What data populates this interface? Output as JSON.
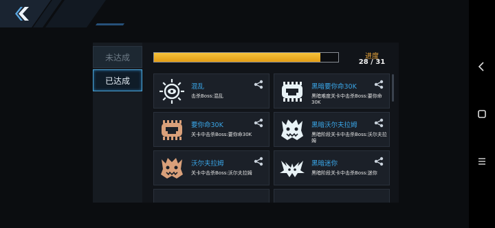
{
  "tabs": {
    "incomplete": "未达成",
    "complete": "已达成"
  },
  "progress": {
    "title": "进度",
    "count": "28 / 31",
    "fraction": 0.903
  },
  "achievements": [
    {
      "name": "混乱",
      "desc": "击杀Boss:混乱",
      "emblem": "eye-emblem",
      "color": "#e8f2f6"
    },
    {
      "name": "黑暗要你命30K",
      "desc": "黑暗难度关卡中击杀Boss:要你命30K",
      "emblem": "bomb-emblem",
      "color": "#e8f2f6"
    },
    {
      "name": "要你命30K",
      "desc": "关卡中击杀Boss:要你命30K",
      "emblem": "bomb-emblem",
      "color": "#d9a07a"
    },
    {
      "name": "黑暗沃尔夫拉姆",
      "desc": "黑暗阶段关卡中击杀Boss:沃尔夫拉姆",
      "emblem": "monster-emblem",
      "color": "#e8f2f6"
    },
    {
      "name": "沃尔夫拉姆",
      "desc": "关卡中击杀Boss:沃尔夫拉姆",
      "emblem": "monster-emblem",
      "color": "#d9a07a"
    },
    {
      "name": "黑暗迷你",
      "desc": "黑暗阶段关卡中击杀Boss:迷你",
      "emblem": "crab-emblem",
      "color": "#e8f2f6"
    }
  ]
}
